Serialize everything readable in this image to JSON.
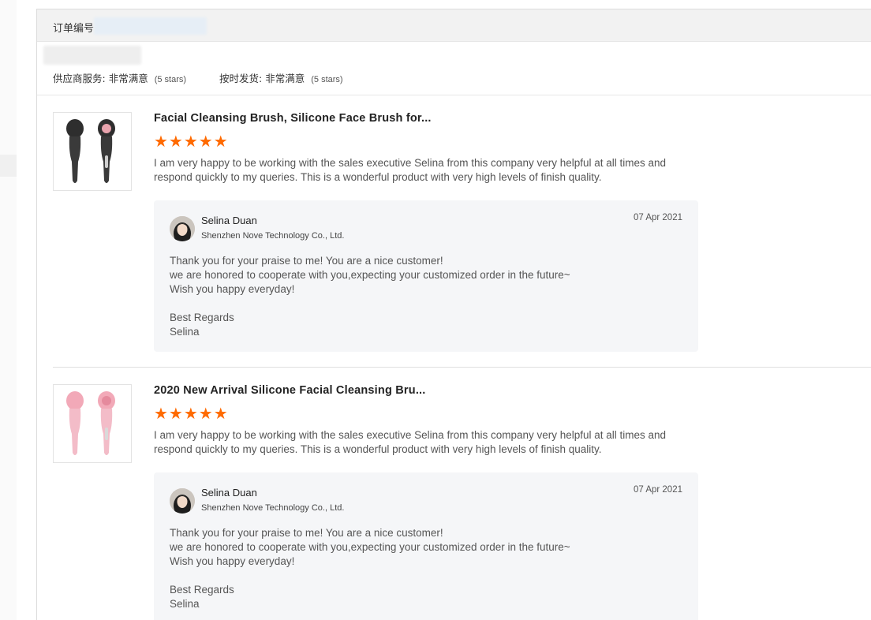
{
  "order": {
    "label": "订单编号"
  },
  "ratings": {
    "supplier_service": {
      "label": "供应商服务:",
      "value": "非常满意",
      "stars_note": "(5 stars)"
    },
    "on_time_shipment": {
      "label": "按时发货:",
      "value": "非常满意",
      "stars_note": "(5 stars)"
    }
  },
  "reviews": [
    {
      "product_title": "Facial Cleansing Brush, Silicone Face Brush for...",
      "thumb_color": "black",
      "stars": "★★★★★",
      "text": "I am very happy to be working with the sales executive Selina from this company very helpful at all times and respond quickly to my queries. This is a wonderful product with very high levels of finish quality.",
      "reply": {
        "name": "Selina Duan",
        "company": "Shenzhen Nove Technology Co., Ltd.",
        "date": "07 Apr 2021",
        "line1": "Thank you for your praise to me! You are a nice customer!",
        "line2": "we are honored to cooperate with you,expecting your customized order in the future~",
        "line3": "Wish you happy everyday!",
        "line4": "Best Regards",
        "line5": "Selina"
      }
    },
    {
      "product_title": "2020 New Arrival Silicone Facial Cleansing Bru...",
      "thumb_color": "pink",
      "stars": "★★★★★",
      "text": "I am very happy to be working with the sales executive Selina from this company very helpful at all times and respond quickly to my queries. This is a wonderful product with very high levels of finish quality.",
      "reply": {
        "name": "Selina Duan",
        "company": "Shenzhen Nove Technology Co., Ltd.",
        "date": "07 Apr 2021",
        "line1": "Thank you for your praise to me! You are a nice customer!",
        "line2": "we are honored to cooperate with you,expecting your customized order in the future~",
        "line3": "Wish you happy everyday!",
        "line4": "Best Regards",
        "line5": "Selina"
      }
    }
  ],
  "colors": {
    "star": "#ff6a00",
    "reply_bg": "#f5f6f8",
    "header_bg": "#f2f2f2"
  }
}
